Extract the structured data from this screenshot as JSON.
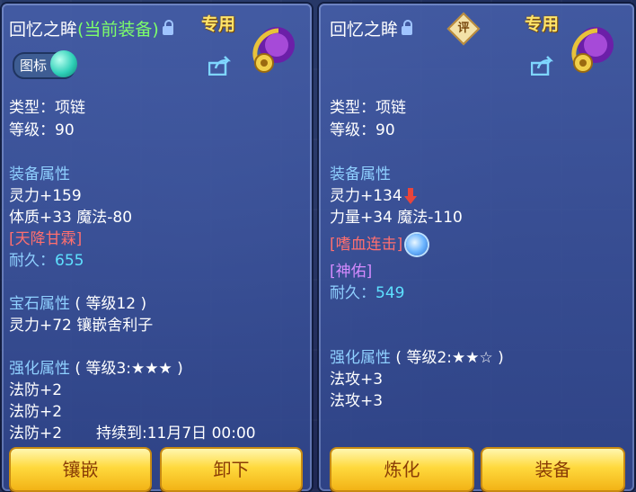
{
  "left": {
    "title_name": "回忆之眸",
    "title_status": "(当前装备)",
    "dedicated": "专用",
    "icon_toggle": "图标",
    "type": "类型：项链",
    "level": "等级：90",
    "equip_header": "装备属性",
    "attr1": "灵力+159",
    "attr2": "体质+33 魔法-80",
    "special": "[天降甘霖]",
    "durability_label": "耐久：",
    "durability_value": "655",
    "gem_header": "宝石属性",
    "gem_level": "( 等级12 )",
    "gem_attr": "灵力+72 镶嵌舍利子",
    "enhance_header": "强化属性",
    "enhance_level": "( 等级3:★★★ )",
    "enh1": "法防+2",
    "enh2": "法防+2",
    "enh3": "法防+2",
    "duration": "持续到:11月7日 00:00",
    "btn_inlay": "镶嵌",
    "btn_unequip": "卸下"
  },
  "right": {
    "title_name": "回忆之眸",
    "rate_label": "评",
    "dedicated": "专用",
    "type": "类型：项链",
    "level": "等级：90",
    "equip_header": "装备属性",
    "attr1": "灵力+134",
    "attr2": "力量+34 魔法-110",
    "special1": "[嗜血连击]",
    "special2": "[神佑]",
    "durability_label": "耐久：",
    "durability_value": "549",
    "enhance_header": "强化属性",
    "enhance_level": "( 等级2:★★☆ )",
    "enh1": "法攻+3",
    "enh2": "法攻+3",
    "btn_refine": "炼化",
    "btn_equip": "装备"
  },
  "colors": {
    "header": "#8fd0ff",
    "cyan": "#5ee1ff",
    "special_red": "#ff6f6f",
    "special_purple": "#d58bff",
    "button": "#ffd93d"
  }
}
